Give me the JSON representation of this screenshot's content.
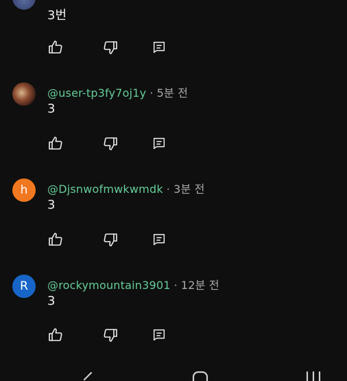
{
  "comments": [
    {
      "handle": "",
      "time": "",
      "text": "3번",
      "avatar_color": "#3a4a78",
      "avatar_letter": ""
    },
    {
      "handle": "@user-tp3fy7oj1y",
      "time": "5분 전",
      "text": "3",
      "avatar_color": "#6b3a2a",
      "avatar_letter": ""
    },
    {
      "handle": "@Djsnwofmwkwmdk",
      "time": "3분 전",
      "text": "3",
      "avatar_color": "#f07820",
      "avatar_letter": "h"
    },
    {
      "handle": "@rockymountain3901",
      "time": "12분 전",
      "text": "3",
      "avatar_color": "#1766c7",
      "avatar_letter": "R"
    }
  ],
  "separator": "·",
  "icons": {
    "like": "thumbs-up-icon",
    "dislike": "thumbs-down-icon",
    "reply": "reply-comment-icon"
  },
  "colors": {
    "background": "#0f0f0f",
    "handle": "#66cc99",
    "meta": "#aaaaaa",
    "text": "#f1f1f1"
  }
}
